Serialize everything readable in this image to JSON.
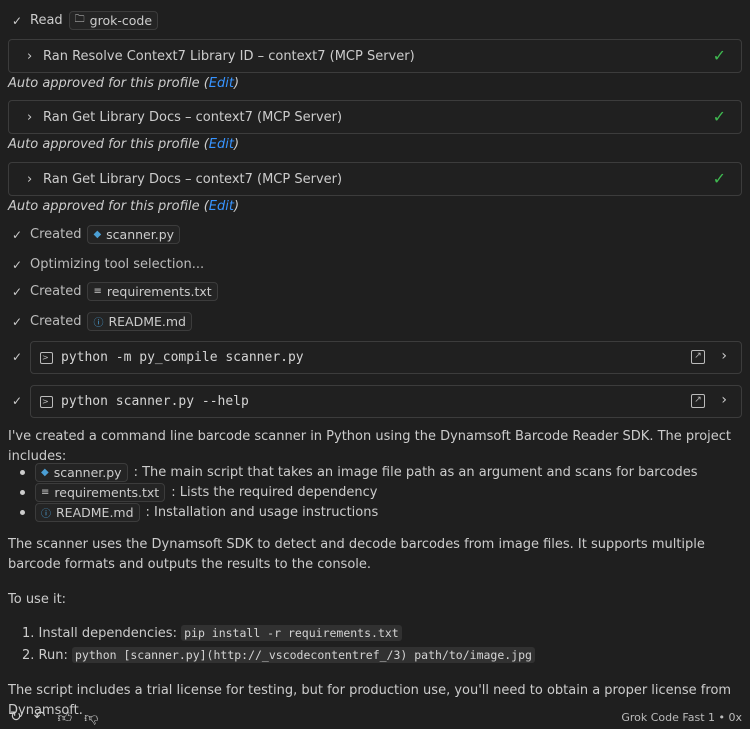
{
  "read": {
    "label": "Read",
    "folder": "grok-code"
  },
  "tool_calls": [
    {
      "label": "Ran Resolve Context7 Library ID – context7 (MCP Server)"
    },
    {
      "label": "Ran Get Library Docs – context7 (MCP Server)"
    },
    {
      "label": "Ran Get Library Docs – context7 (MCP Server)"
    }
  ],
  "approved": {
    "text": "Auto approved for this profile (",
    "link": "Edit",
    "close": ")"
  },
  "steps": {
    "created1": {
      "label": "Created",
      "file": "scanner.py"
    },
    "optimizing": "Optimizing tool selection...",
    "created2": {
      "label": "Created",
      "file": "requirements.txt"
    },
    "created3": {
      "label": "Created",
      "file": "README.md"
    }
  },
  "terminals": [
    {
      "command": "python -m py_compile scanner.py"
    },
    {
      "command": "python scanner.py --help"
    }
  ],
  "response": {
    "intro": "I've created a command line barcode scanner in Python using the Dynamsoft Barcode Reader SDK. The project includes:",
    "files": [
      {
        "file": "scanner.py",
        "desc": ": The main script that takes an image file path as an argument and scans for barcodes"
      },
      {
        "file": "requirements.txt",
        "desc": ": Lists the required dependency"
      },
      {
        "file": "README.md",
        "desc": ": Installation and usage instructions"
      }
    ],
    "para2": "The scanner uses the Dynamsoft SDK to detect and decode barcodes from image files. It supports multiple barcode formats and outputs the results to the console.",
    "to_use": "To use it:",
    "steps": [
      {
        "num": "1.",
        "text": "Install dependencies: ",
        "code": "pip install -r requirements.txt"
      },
      {
        "num": "2.",
        "text": "Run: ",
        "code": "python [scanner.py](http://_vscodecontentref_/3) path/to/image.jpg"
      }
    ],
    "closing": "The script includes a trial license for testing, but for production use, you'll need to obtain a proper license from Dynamsoft."
  },
  "footer": {
    "model": "Grok Code Fast 1 • 0x"
  },
  "colors": {
    "accent_link": "#3794ff",
    "success": "#3fb950",
    "background": "#1f1f1f"
  }
}
